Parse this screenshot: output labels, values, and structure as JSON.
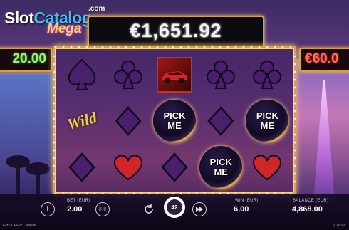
{
  "logo": {
    "part1": "Slot",
    "part2": "Catalog",
    "com": ".com",
    "sub": "Mega"
  },
  "jackpots": {
    "center": "€1,651.92",
    "left": "20.00",
    "right": "€60.0"
  },
  "reels": [
    [
      "spade",
      "wild",
      "diamond"
    ],
    [
      "club",
      "diamond",
      "heart"
    ],
    [
      "car",
      "pick",
      "diamond"
    ],
    [
      "club",
      "diamond",
      "pick"
    ],
    [
      "club",
      "pick",
      "heart"
    ]
  ],
  "wild_label": "Wild",
  "pick_label": {
    "line1": "PICK",
    "line2": "ME"
  },
  "symbol_colors": {
    "suit_fill": "#4a1f6e",
    "suit_edge": "#0e0a1e",
    "heart": "#d0262a"
  },
  "controls": {
    "bet_label": "BET (EUR)",
    "bet_value": "2.00",
    "win_label": "WIN (EUR)",
    "win_value": "6.00",
    "balance_label": "BALANCE (EUR)",
    "balance_value": "4,868.00",
    "autoplay_count": "42",
    "info_icon": "i"
  },
  "footer": {
    "left": "GHT LIFE™ | NetEnt",
    "right": "PLAYIN"
  }
}
